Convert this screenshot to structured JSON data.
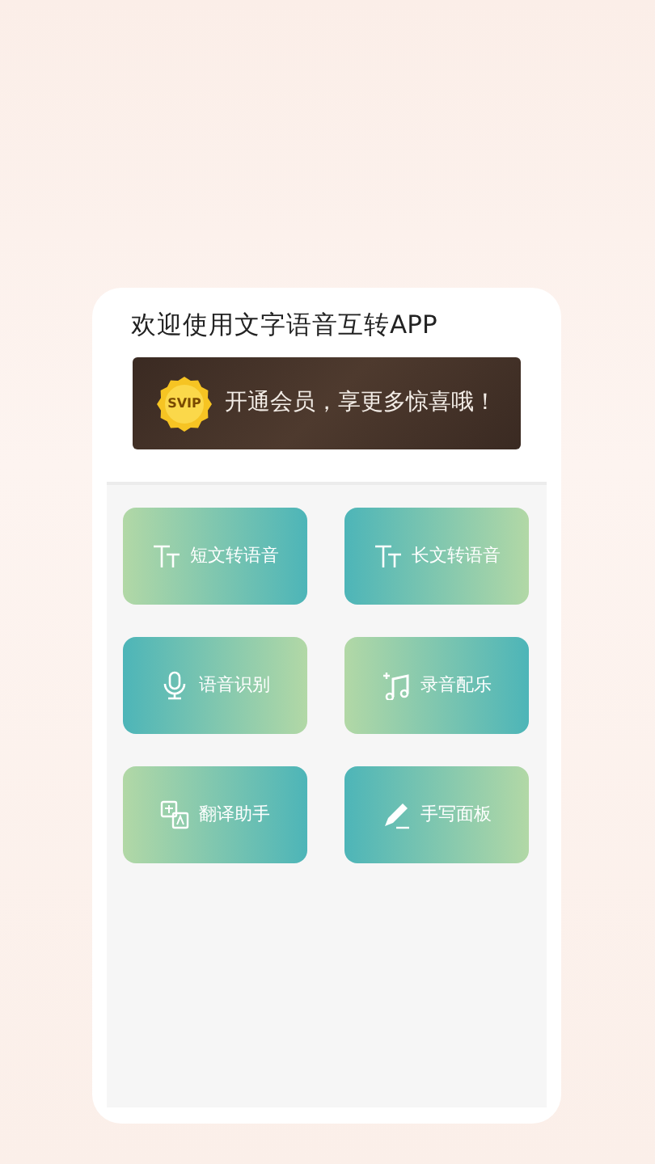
{
  "title": "欢迎使用文字语音互转APP",
  "banner": {
    "badge": "SVIP",
    "text": "开通会员，享更多惊喜哦！"
  },
  "tiles": [
    {
      "label": "短文转语音",
      "kind": "text",
      "reversed": false
    },
    {
      "label": "长文转语音",
      "kind": "text",
      "reversed": true
    },
    {
      "label": "语音识别",
      "kind": "mic",
      "reversed": true
    },
    {
      "label": "录音配乐",
      "kind": "music",
      "reversed": false
    },
    {
      "label": "翻译助手",
      "kind": "translate",
      "reversed": false
    },
    {
      "label": "手写面板",
      "kind": "pen",
      "reversed": true
    }
  ]
}
